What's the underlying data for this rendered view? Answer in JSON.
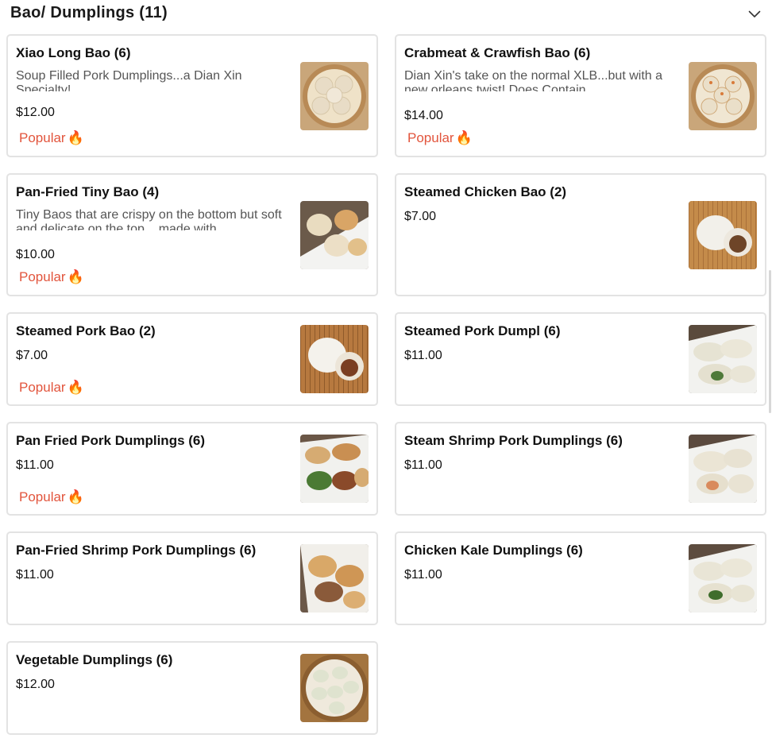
{
  "section": {
    "title": "Bao/ Dumplings (11)",
    "collapse_icon": "chevron-down-icon"
  },
  "items": [
    {
      "name": "Xiao Long Bao (6)",
      "description": "Soup Filled Pork Dumplings...a Dian Xin Specialty!",
      "price": "$12.00",
      "badge": "Popular",
      "image": "xiao-long-bao-photo"
    },
    {
      "name": "Crabmeat & Crawfish Bao (6)",
      "description": "Dian Xin's take on the normal XLB...but with a new orleans twist! Does Contain...",
      "price": "$14.00",
      "badge": "Popular",
      "image": "crabmeat-crawfish-bao-photo"
    },
    {
      "name": "Pan-Fried Tiny Bao (4)",
      "description": "Tiny Baos that are crispy on the bottom but soft and delicate on the top... made with...",
      "price": "$10.00",
      "badge": "Popular",
      "image": "pan-fried-tiny-bao-photo"
    },
    {
      "name": "Steamed Chicken Bao (2)",
      "description": "",
      "price": "$7.00",
      "badge": "",
      "image": "steamed-chicken-bao-photo"
    },
    {
      "name": "Steamed Pork Bao (2)",
      "description": "",
      "price": "$7.00",
      "badge": "Popular",
      "image": "steamed-pork-bao-photo"
    },
    {
      "name": "Steamed Pork Dumpl (6)",
      "description": "",
      "price": "$11.00",
      "badge": "",
      "image": "steamed-pork-dumpling-photo"
    },
    {
      "name": "Pan Fried Pork Dumplings (6)",
      "description": "",
      "price": "$11.00",
      "badge": "Popular",
      "image": "pan-fried-pork-dumplings-photo"
    },
    {
      "name": "Steam Shrimp Pork Dumplings (6)",
      "description": "",
      "price": "$11.00",
      "badge": "",
      "image": "steam-shrimp-pork-dumplings-photo"
    },
    {
      "name": "Pan-Fried Shrimp Pork Dumplings (6)",
      "description": "",
      "price": "$11.00",
      "badge": "",
      "image": "pan-fried-shrimp-pork-dumplings-photo"
    },
    {
      "name": "Chicken Kale Dumplings (6)",
      "description": "",
      "price": "$11.00",
      "badge": "",
      "image": "chicken-kale-dumplings-photo"
    },
    {
      "name": "Vegetable Dumplings (6)",
      "description": "",
      "price": "$12.00",
      "badge": "",
      "image": "vegetable-dumplings-photo"
    }
  ],
  "colors": {
    "badge": "#e2553d",
    "card_border": "#e3e3e3"
  }
}
